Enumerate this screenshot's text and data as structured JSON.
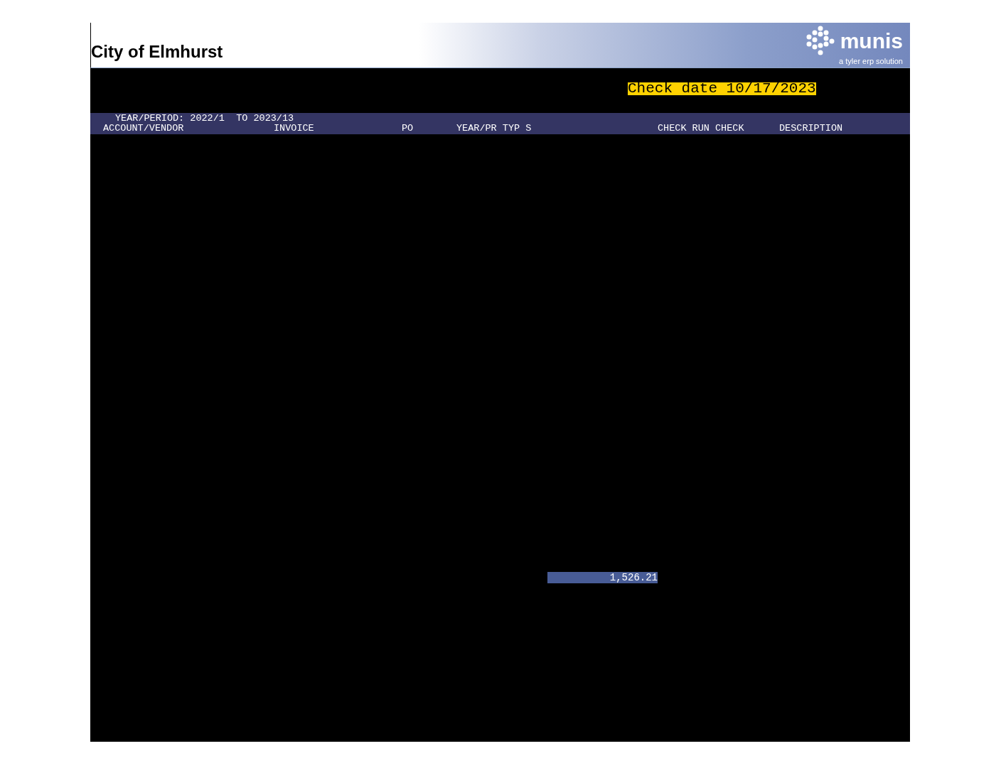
{
  "header": {
    "title": "City of Elmhurst",
    "logo_name": "munis",
    "logo_tagline": "a tyler erp solution"
  },
  "check_date": "Check date 10/17/2023",
  "report_header": {
    "period_line": "YEAR/PERIOD: 2022/1  TO 2023/13",
    "columns": [
      "ACCOUNT/VENDOR",
      "INVOICE",
      "PO",
      "YEAR/PR TYP S",
      "CHECK RUN CHECK",
      "DESCRIPTION"
    ]
  },
  "total": "1,526.21"
}
